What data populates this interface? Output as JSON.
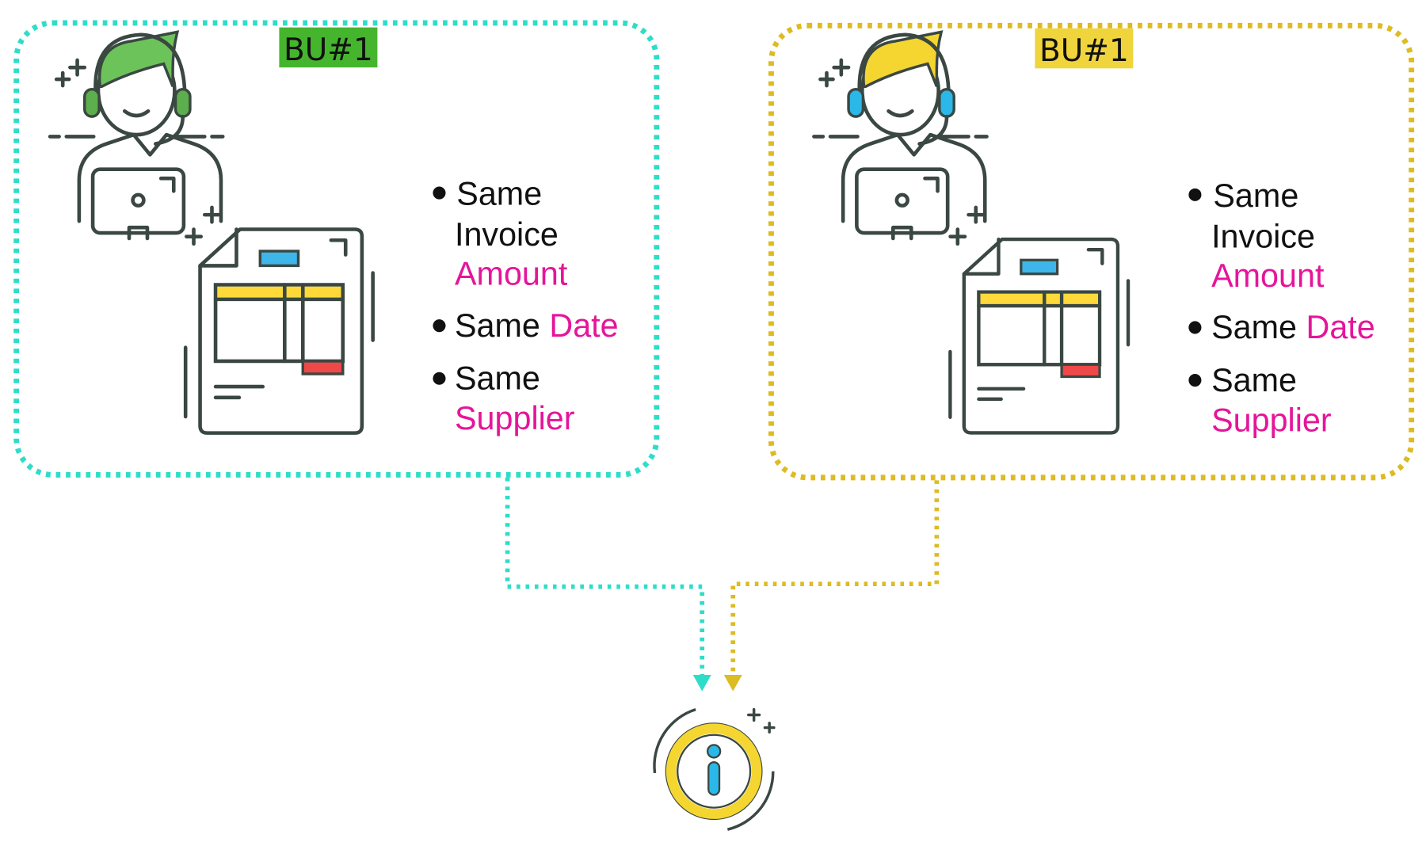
{
  "colors": {
    "cyan": "#2EDDC9",
    "yellow_border": "#DDBB22",
    "green_label": "#45B52E",
    "yellow_label": "#F0D43C",
    "pink_text": "#E5159A",
    "info_blue": "#2BB7E8"
  },
  "panels": [
    {
      "label": "BU#1",
      "hair_color": "#6CC35A",
      "headphone_color": "#5DAE4C",
      "items": [
        {
          "prefix": "Same",
          "line2": "Invoice",
          "highlight": "Amount"
        },
        {
          "prefix": "Same",
          "highlight": "Date"
        },
        {
          "prefix": "Same",
          "highlight": "Supplier"
        }
      ]
    },
    {
      "label": "BU#1",
      "hair_color": "#F5D630",
      "headphone_color": "#2BB7E8",
      "items": [
        {
          "prefix": "Same",
          "line2": "Invoice",
          "highlight": "Amount"
        },
        {
          "prefix": "Same",
          "highlight": "Date"
        },
        {
          "prefix": "Same",
          "highlight": "Supplier"
        }
      ]
    }
  ],
  "icons": {
    "agent": "support-agent-icon",
    "invoice": "invoice-document-icon",
    "result": "info-icon"
  }
}
